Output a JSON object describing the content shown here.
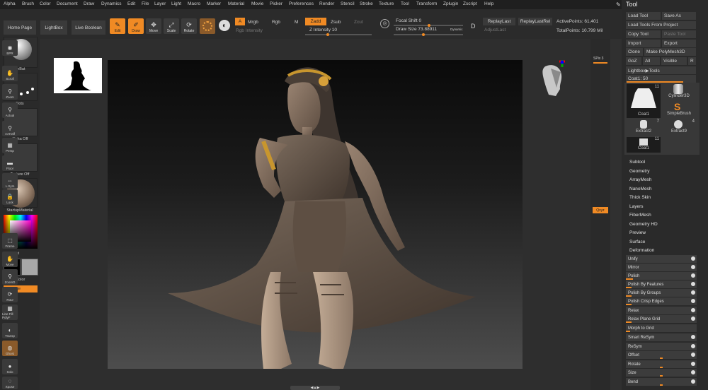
{
  "menu": [
    "Alpha",
    "Brush",
    "Color",
    "Document",
    "Draw",
    "Dynamics",
    "Edit",
    "File",
    "Layer",
    "Light",
    "Macro",
    "Marker",
    "Material",
    "Movie",
    "Picker",
    "Preferences",
    "Render",
    "Stencil",
    "Stroke",
    "Texture",
    "Tool",
    "Transform",
    "Zplugin",
    "Zscript",
    "Help"
  ],
  "topbar": {
    "home_page": "Home Page",
    "lightbox": "LightBox",
    "live_boolean": "Live Boolean",
    "edit": "Edit",
    "draw": "Draw",
    "move": "Move",
    "scale": "Scale",
    "rotate": "Rotate",
    "a_label": "A",
    "mrgb": "Mrgb",
    "rgb": "Rgb",
    "m": "M",
    "rgb_intensity": "Rgb Intensity",
    "zadd": "Zadd",
    "zsub": "Zsub",
    "zcut": "Zcut",
    "z_intensity": "Z Intensity 10",
    "focal_shift": "Focal Shift 0",
    "draw_size": "Draw Size 73.88911",
    "dynamic": "Dynamic",
    "d_label": "D",
    "replay_last": "ReplayLast",
    "replay_last_rel": "ReplayLastRel",
    "adjust_last": "AdjustLast",
    "active_points": "ActivePoints: 61,401",
    "total_points": "TotalPoints: 10.799 Mil"
  },
  "left_shelf": {
    "brush": "SnBat",
    "stroke": "Dots",
    "alpha": "Alpha Off",
    "texture": "Texture Off",
    "material": "StartupMaterial",
    "gradient": "Gradient",
    "switch_color": "SwitchColor",
    "alternate": "Alternate"
  },
  "right_shelf": [
    "BPR",
    "SPix 3",
    "Scroll",
    "Zoom",
    "Actual",
    "AAHalf",
    "Persp",
    "Floor",
    "L.Sym",
    "Lock",
    "Qxyz",
    "Frame",
    "Move",
    "ZoomD",
    "RotJ",
    "Line Fill PolyF",
    "Transp",
    "Ghost",
    "Solo",
    "Xpose"
  ],
  "tool_panel": {
    "title": "Tool",
    "load_tool": "Load Tool",
    "save_as": "Save As",
    "load_from_project": "Load Tools From Project",
    "copy_tool": "Copy Tool",
    "paste_tool": "Paste Tool",
    "import": "Import",
    "export": "Export",
    "clone": "Clone",
    "make_polymesh": "Make PolyMesh3D",
    "goz": "GoZ",
    "all": "All",
    "visible": "Visible",
    "r": "R",
    "lightbox_tools": "Lightbox▶Tools",
    "coat_slider": "Coat1: 50",
    "tiles": [
      {
        "name": "Coat1",
        "count": "11"
      },
      {
        "name": "Cylinder3D",
        "count": ""
      },
      {
        "name": "SimpleBrush",
        "count": ""
      },
      {
        "name": "Extract2",
        "count": "7"
      },
      {
        "name": "Extract9",
        "count": "4"
      },
      {
        "name": "Coat1",
        "count": "11"
      }
    ],
    "subpalettes": [
      "Subtool",
      "Geometry",
      "ArrayMesh",
      "NanoMesh",
      "Thick Skin",
      "Layers",
      "FiberMesh",
      "Geometry HD",
      "Preview",
      "Surface",
      "Deformation"
    ],
    "deformation": [
      "Unify",
      "Mirror",
      "Polish",
      "Polish By Features",
      "Polish By Groups",
      "Polish Crisp Edges",
      "Relax",
      "Relax Plane Grid",
      "Morph to Grid",
      "Smart ReSym",
      "ReSym",
      "Offset",
      "Rotate",
      "Size",
      "Bend"
    ]
  },
  "colors": {
    "accent": "#f08a24",
    "panel": "#2a2a2a",
    "button": "#3a3a3a"
  }
}
